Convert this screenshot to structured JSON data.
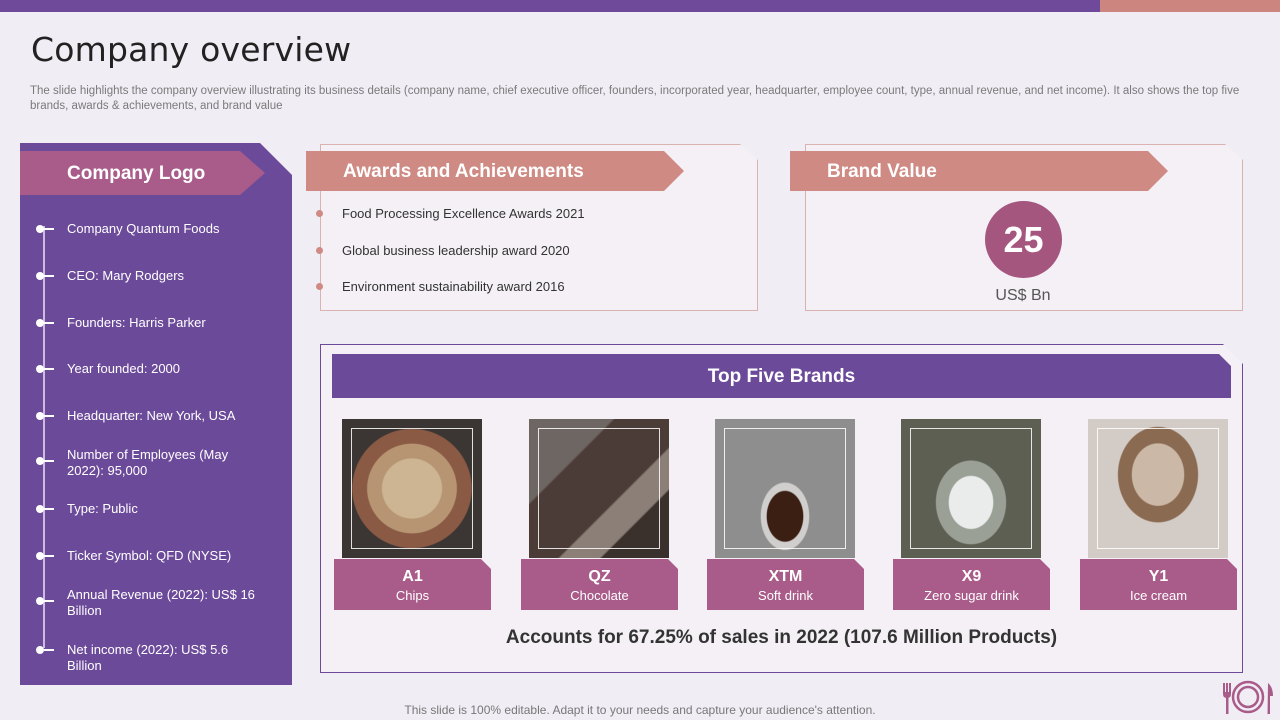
{
  "slide": {
    "title": "Company overview",
    "subtitle": "The slide highlights the company overview illustrating its business details (company name, chief executive officer, founders, incorporated year, headquarter, employee count, type, annual revenue, and net income). It also shows the top five brands, awards & achievements, and brand value",
    "footer": "This slide is 100% editable. Adapt it to your needs and capture your audience's attention."
  },
  "company": {
    "heading": "Company Logo",
    "items": [
      "Company Quantum Foods",
      "CEO: Mary Rodgers",
      "Founders: Harris Parker",
      "Year founded: 2000",
      "Headquarter: New York, USA",
      "Number of Employees (May 2022): 95,000",
      "Type: Public",
      "Ticker Symbol: QFD (NYSE)",
      "Annual Revenue (2022): US$ 16 Billion",
      "Net income (2022): US$ 5.6 Billion"
    ]
  },
  "awards": {
    "heading": "Awards and Achievements",
    "items": [
      "Food Processing Excellence Awards 2021",
      "Global business leadership award 2020",
      "Environment  sustainability award 2016"
    ]
  },
  "brand_value": {
    "heading": "Brand Value",
    "value": "25",
    "unit": "US$ Bn"
  },
  "top_brands": {
    "heading": "Top Five Brands",
    "brands": [
      {
        "code": "A1",
        "category": "Chips"
      },
      {
        "code": "QZ",
        "category": "Chocolate"
      },
      {
        "code": "XTM",
        "category": "Soft drink"
      },
      {
        "code": "X9",
        "category": "Zero  sugar drink"
      },
      {
        "code": "Y1",
        "category": "Ice cream"
      }
    ],
    "summary": "Accounts for 67.25% of sales in 2022 (107.6 Million Products)"
  },
  "colors": {
    "primary_purple": "#6c4a9a",
    "accent_pink": "#cf8a83",
    "magenta": "#a95c8a"
  }
}
